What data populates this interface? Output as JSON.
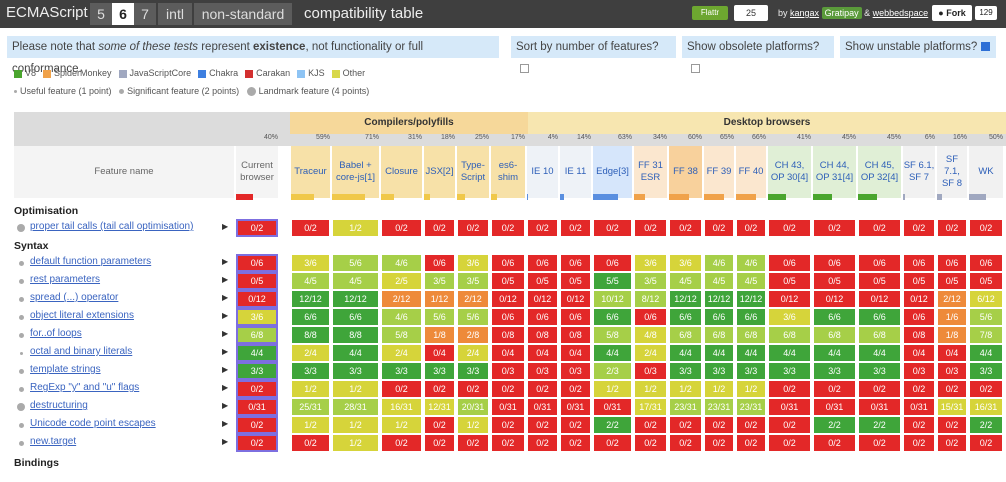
{
  "header": {
    "brand": "ECMAScript",
    "versions": [
      "5",
      "6",
      "7",
      "intl",
      "non-standard"
    ],
    "active_version": "6",
    "page_title": "compatibility table",
    "flattr_label": "Flattr",
    "flattr_count": "25",
    "by_text": "by",
    "author1": "kangax",
    "gratipay": "Gratipay",
    "amp": "&",
    "author2": "webbedspace",
    "fork_label": "Fork",
    "fork_count": "129"
  },
  "notice": {
    "pre": "Please note that ",
    "italic": "some of these tests",
    "mid": " represent ",
    "bold": "existence",
    "post": ", not functionality or full conformance."
  },
  "options": {
    "sort": "Sort by number of features?",
    "obsolete": "Show obsolete platforms?",
    "unstable": "Show unstable platforms?"
  },
  "legend_engines": [
    {
      "name": "V8",
      "color": "#4aa52e"
    },
    {
      "name": "SpiderMonkey",
      "color": "#f0a24a"
    },
    {
      "name": "JavaScriptCore",
      "color": "#a0a8c0"
    },
    {
      "name": "Chakra",
      "color": "#3d7fe0"
    },
    {
      "name": "Carakan",
      "color": "#d32f2f"
    },
    {
      "name": "KJS",
      "color": "#8ec4f4"
    },
    {
      "name": "Other",
      "color": "#d8d84a"
    }
  ],
  "legend_points": [
    "Useful feature (1 point)",
    "Significant feature (2 points)",
    "Landmark feature (4 points)"
  ],
  "groups": {
    "compilers": "Compilers/polyfills",
    "desktop": "Desktop browsers"
  },
  "feature_header": "Feature name",
  "columns": [
    {
      "label": "Current browser",
      "pct": "40%"
    },
    {
      "label": "Traceur",
      "pct": "59%"
    },
    {
      "label": "Babel + core-js[1]",
      "pct": "71%"
    },
    {
      "label": "Closure",
      "pct": "31%"
    },
    {
      "label": "JSX[2]",
      "pct": "18%"
    },
    {
      "label": "Type-Script",
      "pct": "25%"
    },
    {
      "label": "es6-shim",
      "pct": "17%"
    },
    {
      "label": "IE 10",
      "pct": "4%"
    },
    {
      "label": "IE 11",
      "pct": "14%"
    },
    {
      "label": "Edge[3]",
      "pct": "63%"
    },
    {
      "label": "FF 31 ESR",
      "pct": "34%"
    },
    {
      "label": "FF 38",
      "pct": "60%"
    },
    {
      "label": "FF 39",
      "pct": "65%"
    },
    {
      "label": "FF 40",
      "pct": "66%"
    },
    {
      "label": "CH 43, OP 30[4]",
      "pct": "41%"
    },
    {
      "label": "CH 44, OP 31[4]",
      "pct": "45%"
    },
    {
      "label": "CH 45, OP 32[4]",
      "pct": "45%"
    },
    {
      "label": "SF 6.1, SF 7",
      "pct": "6%"
    },
    {
      "label": "SF 7.1, SF 8",
      "pct": "16%"
    },
    {
      "label": "WK",
      "pct": "50%"
    }
  ],
  "sections": {
    "optimisation": "Optimisation",
    "syntax": "Syntax",
    "bindings": "Bindings"
  },
  "rows": [
    {
      "name": "proper tail calls (tail call optimisation)",
      "cells": [
        "0/2",
        "0/2",
        "1/2",
        "0/2",
        "0/2",
        "0/2",
        "0/2",
        "0/2",
        "0/2",
        "0/2",
        "0/2",
        "0/2",
        "0/2",
        "0/2",
        "0/2",
        "0/2",
        "0/2",
        "0/2",
        "0/2",
        "0/2"
      ]
    },
    {
      "name": "default function parameters",
      "cells": [
        "0/6",
        "3/6",
        "5/6",
        "4/6",
        "0/6",
        "3/6",
        "0/6",
        "0/6",
        "0/6",
        "0/6",
        "3/6",
        "3/6",
        "4/6",
        "4/6",
        "0/6",
        "0/6",
        "0/6",
        "0/6",
        "0/6",
        "0/6"
      ]
    },
    {
      "name": "rest parameters",
      "cells": [
        "0/5",
        "4/5",
        "4/5",
        "2/5",
        "3/5",
        "3/5",
        "0/5",
        "0/5",
        "0/5",
        "5/5",
        "3/5",
        "4/5",
        "4/5",
        "4/5",
        "0/5",
        "0/5",
        "0/5",
        "0/5",
        "0/5",
        "0/5"
      ]
    },
    {
      "name": "spread (...) operator",
      "cells": [
        "0/12",
        "12/12",
        "12/12",
        "2/12",
        "1/12",
        "2/12",
        "0/12",
        "0/12",
        "0/12",
        "10/12",
        "8/12",
        "12/12",
        "12/12",
        "12/12",
        "0/12",
        "0/12",
        "0/12",
        "0/12",
        "2/12",
        "6/12"
      ]
    },
    {
      "name": "object literal extensions",
      "cells": [
        "3/6",
        "6/6",
        "6/6",
        "4/6",
        "5/6",
        "5/6",
        "0/6",
        "0/6",
        "0/6",
        "6/6",
        "0/6",
        "6/6",
        "6/6",
        "6/6",
        "3/6",
        "6/6",
        "6/6",
        "0/6",
        "1/6",
        "5/6"
      ]
    },
    {
      "name": "for..of loops",
      "cells": [
        "6/8",
        "8/8",
        "8/8",
        "5/8",
        "1/8",
        "2/8",
        "0/8",
        "0/8",
        "0/8",
        "5/8",
        "4/8",
        "6/8",
        "6/8",
        "6/8",
        "6/8",
        "6/8",
        "6/8",
        "0/8",
        "1/8",
        "7/8"
      ]
    },
    {
      "name": "octal and binary literals",
      "cells": [
        "4/4",
        "2/4",
        "4/4",
        "2/4",
        "0/4",
        "2/4",
        "0/4",
        "0/4",
        "0/4",
        "4/4",
        "2/4",
        "4/4",
        "4/4",
        "4/4",
        "4/4",
        "4/4",
        "4/4",
        "0/4",
        "0/4",
        "4/4"
      ]
    },
    {
      "name": "template strings",
      "cells": [
        "3/3",
        "3/3",
        "3/3",
        "3/3",
        "3/3",
        "3/3",
        "0/3",
        "0/3",
        "0/3",
        "2/3",
        "0/3",
        "3/3",
        "3/3",
        "3/3",
        "3/3",
        "3/3",
        "3/3",
        "0/3",
        "0/3",
        "3/3"
      ]
    },
    {
      "name": "RegExp \"y\" and \"u\" flags",
      "cells": [
        "0/2",
        "1/2",
        "1/2",
        "0/2",
        "0/2",
        "0/2",
        "0/2",
        "0/2",
        "0/2",
        "1/2",
        "1/2",
        "1/2",
        "1/2",
        "1/2",
        "0/2",
        "0/2",
        "0/2",
        "0/2",
        "0/2",
        "0/2"
      ]
    },
    {
      "name": "destructuring",
      "cells": [
        "0/31",
        "25/31",
        "28/31",
        "16/31",
        "12/31",
        "20/31",
        "0/31",
        "0/31",
        "0/31",
        "0/31",
        "17/31",
        "23/31",
        "23/31",
        "23/31",
        "0/31",
        "0/31",
        "0/31",
        "0/31",
        "15/31",
        "16/31"
      ]
    },
    {
      "name": "Unicode code point escapes",
      "cells": [
        "0/2",
        "1/2",
        "1/2",
        "1/2",
        "0/2",
        "1/2",
        "0/2",
        "0/2",
        "0/2",
        "2/2",
        "0/2",
        "0/2",
        "0/2",
        "0/2",
        "0/2",
        "2/2",
        "2/2",
        "0/2",
        "0/2",
        "2/2"
      ]
    },
    {
      "name": "new.target",
      "cells": [
        "0/2",
        "0/2",
        "1/2",
        "0/2",
        "0/2",
        "0/2",
        "0/2",
        "0/2",
        "0/2",
        "0/2",
        "0/2",
        "0/2",
        "0/2",
        "0/2",
        "0/2",
        "0/2",
        "0/2",
        "0/2",
        "0/2",
        "0/2"
      ]
    }
  ],
  "row_points": [
    4,
    2,
    2,
    2,
    2,
    2,
    1,
    2,
    2,
    4,
    2,
    2
  ],
  "colors": {
    "none": "#e32828",
    "partial_low": "#ee8a3a",
    "partial_mid": "#d6d43a",
    "partial_high": "#a6cf48",
    "full": "#3fa53a"
  }
}
